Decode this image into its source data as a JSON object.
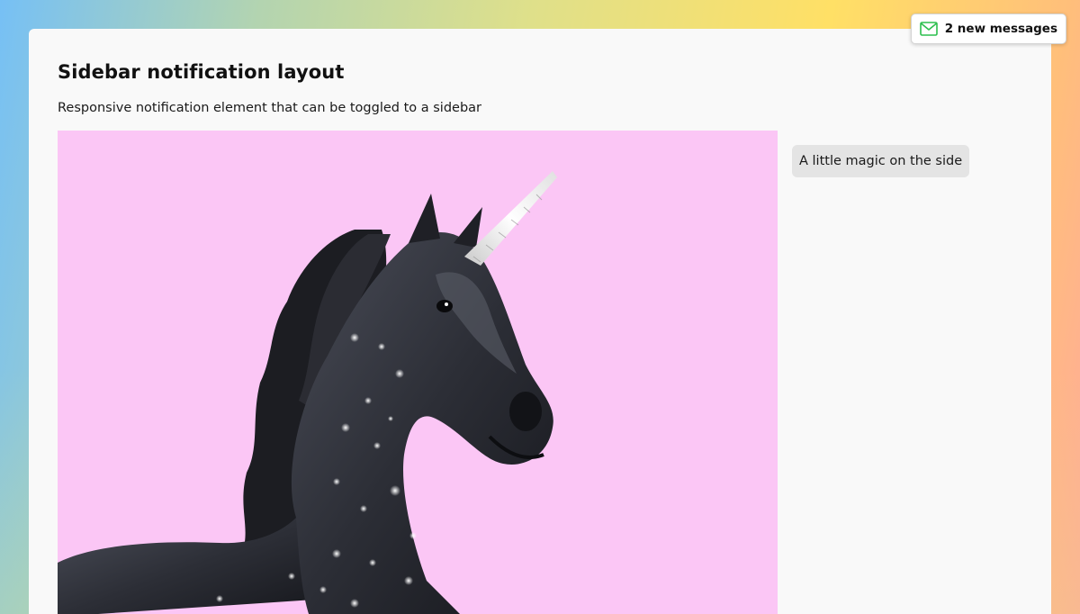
{
  "page": {
    "title": "Sidebar notification layout",
    "subtitle": "Responsive notification element that can be toggled to a sidebar"
  },
  "sidebar": {
    "note": "A little magic on the side"
  },
  "notification": {
    "label": "2 new messages",
    "icon": "envelope-icon",
    "icon_color": "#2dbf4e"
  },
  "hero_image": {
    "subject": "black unicorn with sparkles",
    "background_color": "#fbc6f5"
  }
}
